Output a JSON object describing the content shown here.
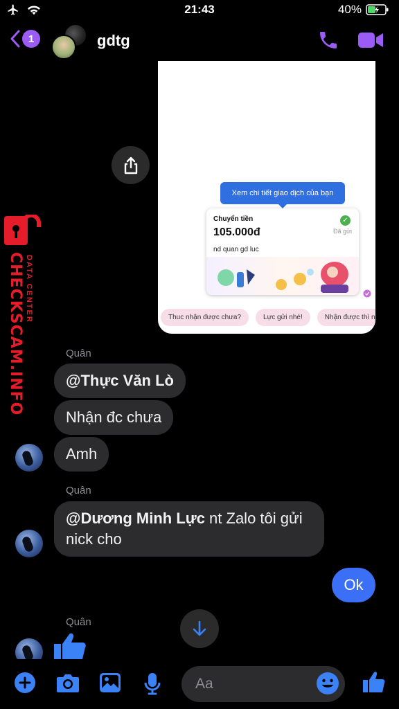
{
  "status_bar": {
    "time": "21:43",
    "battery": "40%"
  },
  "header": {
    "back_badge": "1",
    "title": "gdtg"
  },
  "shared_image": {
    "tooltip": "Xem chi tiết giao dịch của bạn",
    "transaction": {
      "type": "Chuyển tiền",
      "amount": "105.000đ",
      "status": "Đã gửi",
      "note": "nd quan gd luc"
    },
    "quick_replies": [
      "Thuc nhận được chưa?",
      "Lực gửi nhé!",
      "Nhận được thì n"
    ]
  },
  "watermark": {
    "text": "CHECKSCAM.INFO",
    "subtext": "DATA CENTER"
  },
  "messages": {
    "group1_sender": "Quân",
    "m1_mention": "@Thực Văn   Lò",
    "m2": "Nhận đc chưa",
    "m3": "Amh",
    "group2_sender": "Quân",
    "m4_mention": "@Dương Minh Lực",
    "m4_text": " nt Zalo tôi gửi nick cho",
    "outgoing": "Ok",
    "group3_sender": "Quân"
  },
  "composer": {
    "placeholder": "Aa"
  },
  "colors": {
    "accent": "#9b5cf5",
    "outgoing_bubble": "#3b6ff5",
    "incoming_bubble": "#2c2c2e",
    "composer_icons": "#3b82f6"
  }
}
